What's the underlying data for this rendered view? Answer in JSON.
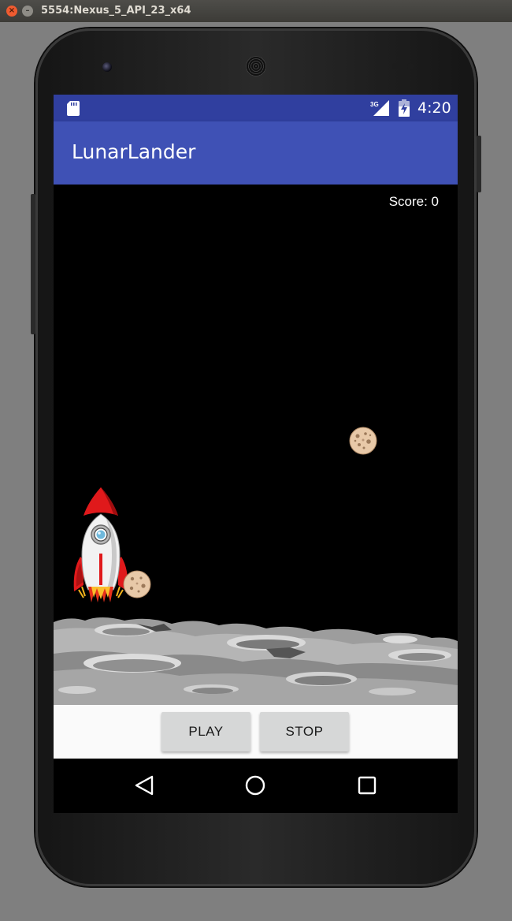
{
  "window": {
    "title": "5554:Nexus_5_API_23_x64",
    "close_glyph": "×",
    "minimize_glyph": "–"
  },
  "statusbar": {
    "left_icon": "sd-card-icon",
    "network_label": "3G",
    "network_icon": "cell-signal-icon",
    "battery_icon": "battery-charging-icon",
    "time": "4:20"
  },
  "appbar": {
    "title": "LunarLander",
    "color": "#3f51b5",
    "status_color": "#303f9f"
  },
  "game": {
    "score_text": "Score: 0",
    "background": "#000000",
    "sprites": [
      "rocket-icon",
      "asteroid-icon",
      "asteroid-icon",
      "moon-surface"
    ]
  },
  "controls": {
    "play_label": "PLAY",
    "stop_label": "STOP"
  },
  "navigation": {
    "back": "back-icon",
    "home": "home-icon",
    "recents": "recents-icon"
  }
}
